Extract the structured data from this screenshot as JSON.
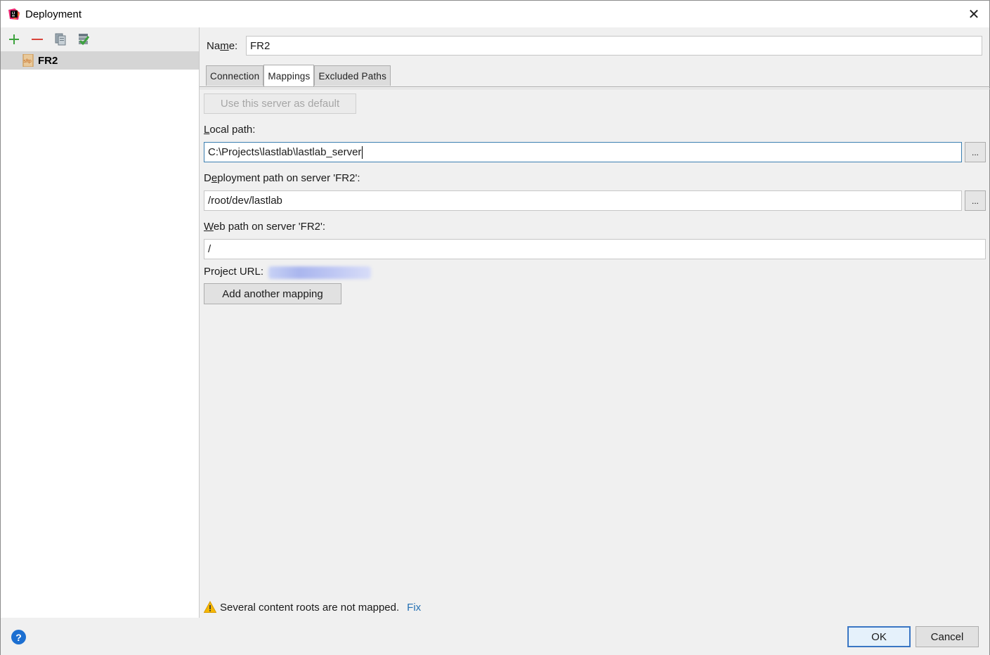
{
  "window": {
    "title": "Deployment",
    "close_symbol": "✕"
  },
  "sidebar": {
    "toolbar": [
      {
        "icon": "add-icon",
        "color": "#3da33d"
      },
      {
        "icon": "remove-icon",
        "color": "#d9453b"
      },
      {
        "icon": "copy-icon"
      },
      {
        "icon": "set-default-icon",
        "color": "#3da33d"
      }
    ],
    "servers": [
      {
        "label": "FR2",
        "icon": "sftp-icon",
        "icon_text": "sftp",
        "selected": true
      }
    ]
  },
  "form": {
    "name_label_pre": "Na",
    "name_label_mn": "m",
    "name_label_post": "e:",
    "name_value": "FR2",
    "tabs": [
      {
        "label": "Connection",
        "active": false
      },
      {
        "label": "Mappings",
        "active": true
      },
      {
        "label": "Excluded Paths",
        "active": false
      }
    ],
    "use_default_button": "Use this server as default",
    "local_path_label_mn": "L",
    "local_path_label_rest": "ocal path:",
    "local_path_value": "C:\\Projects\\lastlab\\lastlab_server",
    "deployment_path_label_pre": "D",
    "deployment_path_label_mn": "e",
    "deployment_path_label_rest": "ployment path on server 'FR2':",
    "deployment_path_value": "/root/dev/lastlab",
    "web_path_label_mn": "W",
    "web_path_label_rest": "eb path on server 'FR2':",
    "web_path_value": "/",
    "project_url_label": "Project URL:",
    "browse_label": "...",
    "add_mapping_button": "Add another mapping",
    "warning_text": "Several content roots are not mapped.",
    "fix_link": "Fix"
  },
  "footer": {
    "help_label": "?",
    "ok_label": "OK",
    "cancel_label": "Cancel"
  },
  "colors": {
    "accent": "#3a76c4",
    "link": "#2470b3",
    "warning": "#f5b800",
    "help": "#1c6fd1"
  }
}
